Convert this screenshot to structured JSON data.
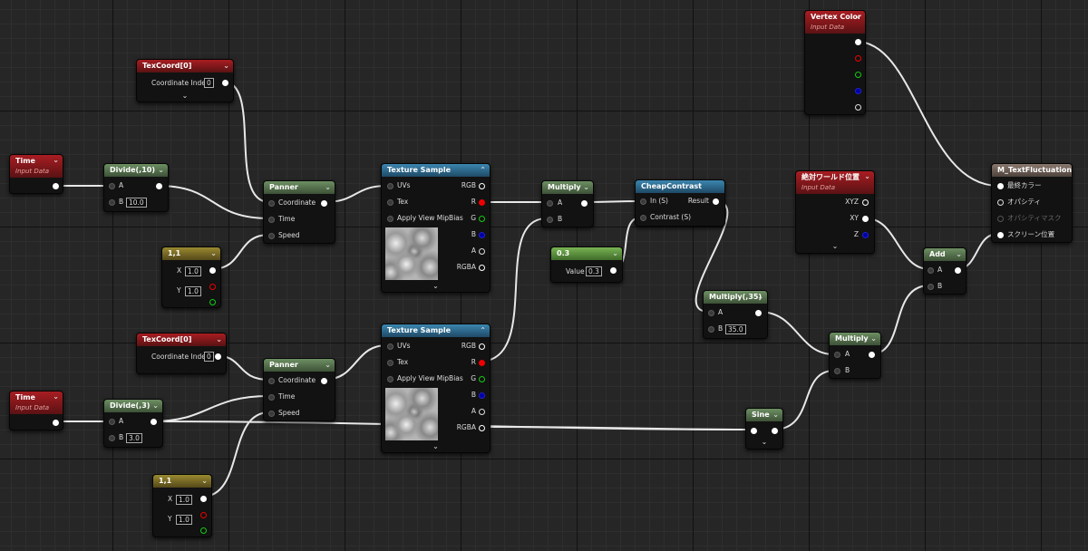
{
  "nodes": {
    "texcoord1": {
      "title": "TexCoord[0]",
      "index_label": "Coordinate Index",
      "index_value": "0",
      "expand": "⌄"
    },
    "time1": {
      "title": "Time",
      "subtitle": "Input Data"
    },
    "divide10": {
      "title": "Divide(,10)",
      "a_label": "A",
      "b_label": "B",
      "b_value": "10.0"
    },
    "vec1_1": {
      "title": "1,1",
      "x_label": "X",
      "x_value": "1.0",
      "y_label": "Y",
      "y_value": "1.0"
    },
    "panner1": {
      "title": "Panner",
      "coord_label": "Coordinate",
      "time_label": "Time",
      "speed_label": "Speed"
    },
    "texsample1": {
      "title": "Texture Sample",
      "uvs_label": "UVs",
      "tex_label": "Tex",
      "mip_label": "Apply View MipBias",
      "rgb": "RGB",
      "r": "R",
      "g": "G",
      "b": "B",
      "a": "A",
      "rgba": "RGBA",
      "expand": "⌄"
    },
    "multiply1": {
      "title": "Multiply",
      "a_label": "A",
      "b_label": "B"
    },
    "const03": {
      "title": "0.3",
      "value_label": "Value",
      "value": "0.3"
    },
    "cheapcontrast": {
      "title": "CheapContrast",
      "in_label": "In (S)",
      "contrast_label": "Contrast (S)",
      "result_label": "Result"
    },
    "vertexcolor": {
      "title": "Vertex Color",
      "subtitle": "Input Data"
    },
    "worldpos": {
      "title": "絶対ワールド位置",
      "subtitle": "Input Data",
      "xyz": "XYZ",
      "xy": "XY",
      "z": "Z",
      "expand": "⌄"
    },
    "result": {
      "title": "M_TextFluctuation",
      "pins": [
        "最終カラー",
        "オパシティ",
        "オパシティマスク",
        "スクリーン位置"
      ]
    },
    "add": {
      "title": "Add",
      "a_label": "A",
      "b_label": "B"
    },
    "multiply35": {
      "title": "Multiply(,35)",
      "a_label": "A",
      "b_label": "B",
      "b_value": "35.0"
    },
    "multiply2": {
      "title": "Multiply",
      "a_label": "A",
      "b_label": "B"
    },
    "texcoord2": {
      "title": "TexCoord[0]",
      "index_label": "Coordinate Index",
      "index_value": "0"
    },
    "time2": {
      "title": "Time",
      "subtitle": "Input Data"
    },
    "divide3": {
      "title": "Divide(,3)",
      "a_label": "A",
      "b_label": "B",
      "b_value": "3.0"
    },
    "panner2": {
      "title": "Panner",
      "coord_label": "Coordinate",
      "time_label": "Time",
      "speed_label": "Speed"
    },
    "texsample2": {
      "title": "Texture Sample",
      "uvs_label": "UVs",
      "tex_label": "Tex",
      "mip_label": "Apply View MipBias",
      "rgb": "RGB",
      "r": "R",
      "g": "G",
      "b": "B",
      "a": "A",
      "rgba": "RGBA",
      "expand": "⌄"
    },
    "vec1_1b": {
      "title": "1,1",
      "x_label": "X",
      "x_value": "1.0",
      "y_label": "Y",
      "y_value": "1.0"
    },
    "sine": {
      "title": "Sine",
      "expand": "⌄"
    }
  },
  "icons": {
    "chevron": "chevron-down-icon",
    "pin": "pin-icon"
  },
  "colors": {
    "wire": "#e8e8e8",
    "header_red": "#a81d22",
    "header_green": "#6d8f63",
    "header_blue": "#3b86b0",
    "header_olive": "#9a8a30",
    "header_lightgreen": "#79b453",
    "header_result": "#8a786d"
  }
}
